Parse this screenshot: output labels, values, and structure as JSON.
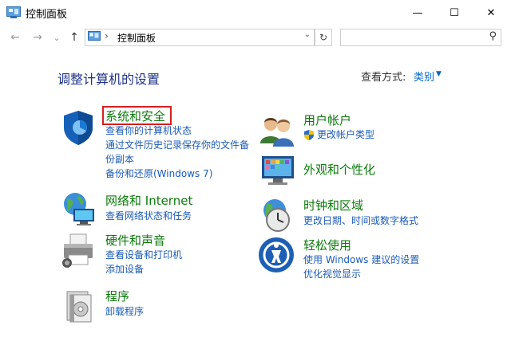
{
  "window": {
    "title": "控制面板",
    "minimize": "—",
    "maximize": "☐",
    "close": "✕"
  },
  "nav": {
    "back": "←",
    "forward": "→",
    "recent": "⌄",
    "up": "↑",
    "address_sep": "›",
    "address_text": "控制面板",
    "address_drop": "⌄",
    "refresh": "↻",
    "search_placeholder": "",
    "search_icon": "⚲"
  },
  "content": {
    "heading": "调整计算机的设置",
    "view_by_label": "查看方式:",
    "view_by_value": "类别"
  },
  "categories": [
    {
      "id": "security",
      "title": "系统和安全",
      "icon": "shield-icon",
      "links": [
        "查看你的计算机状态",
        "通过文件历史记录保存你的文件备",
        "份副本",
        "备份和还原(Windows 7)"
      ]
    },
    {
      "id": "network",
      "title": "网络和 Internet",
      "icon": "network-icon",
      "links": [
        "查看网络状态和任务"
      ]
    },
    {
      "id": "hardware",
      "title": "硬件和声音",
      "icon": "printer-icon",
      "links": [
        "查看设备和打印机",
        "添加设备"
      ]
    },
    {
      "id": "programs",
      "title": "程序",
      "icon": "programs-icon",
      "links": [
        "卸载程序"
      ]
    },
    {
      "id": "accounts",
      "title": "用户帐户",
      "icon": "users-icon",
      "links": [
        "更改帐户类型"
      ]
    },
    {
      "id": "appearance",
      "title": "外观和个性化",
      "icon": "display-icon",
      "links": []
    },
    {
      "id": "clock",
      "title": "时钟和区域",
      "icon": "clock-globe-icon",
      "links": [
        "更改日期、时间或数字格式"
      ]
    },
    {
      "id": "ease",
      "title": "轻松使用",
      "icon": "ease-of-access-icon",
      "links": [
        "使用 Windows 建议的设置",
        "优化视觉显示"
      ]
    }
  ]
}
